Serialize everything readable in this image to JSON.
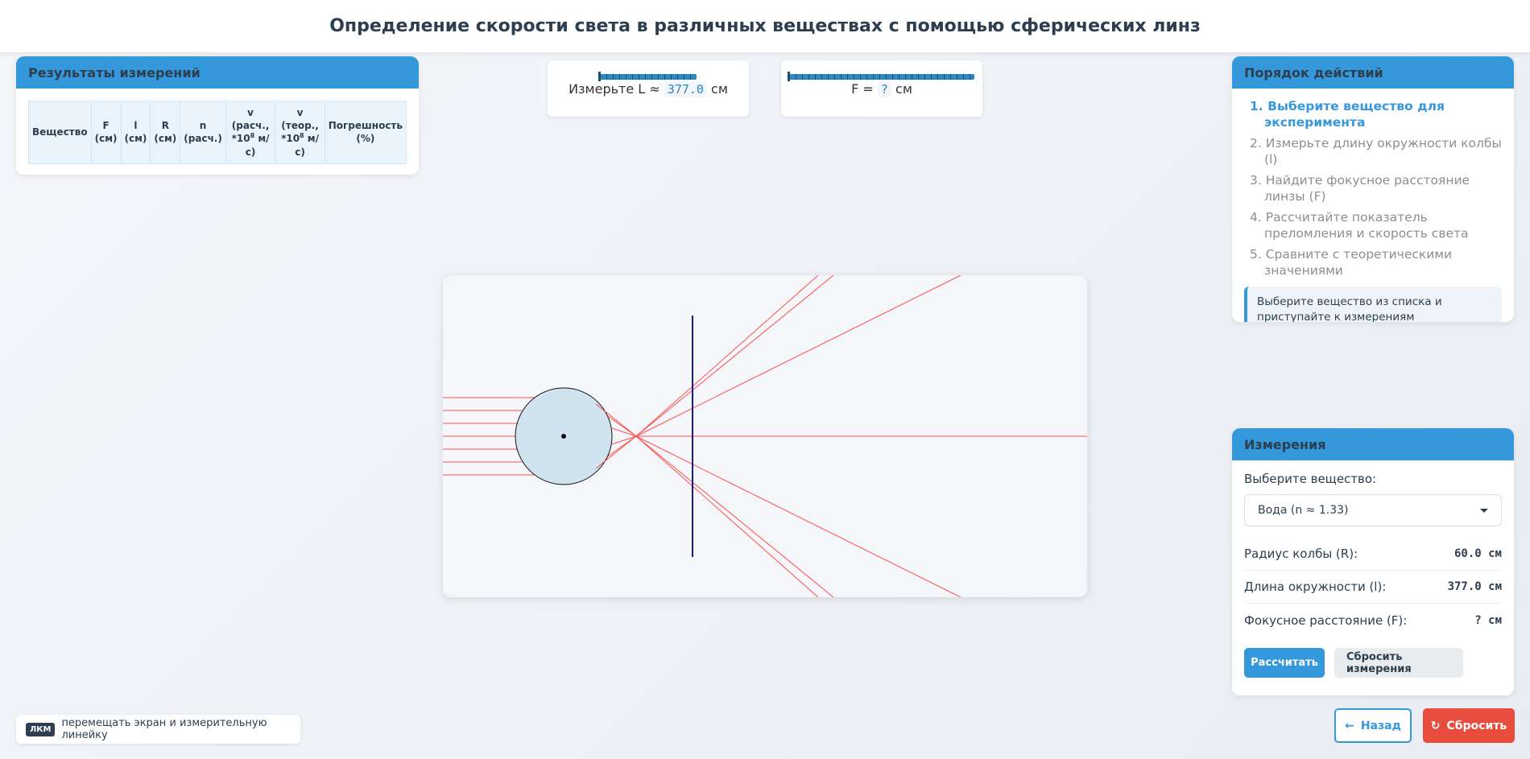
{
  "header": {
    "title": "Определение скорости света в различных веществах с помощью сферических линз"
  },
  "results": {
    "title": "Результаты измерений",
    "columns": [
      {
        "line1": "Вещество",
        "line2": ""
      },
      {
        "line1": "F",
        "line2": "(см)"
      },
      {
        "line1": "l",
        "line2": "(см)"
      },
      {
        "line1": "R",
        "line2": "(см)"
      },
      {
        "line1": "n",
        "line2": "(расч.)"
      },
      {
        "line1": "v (расч.,",
        "line2_pre": "*10",
        "sup": "8",
        "line2_post": " м/с)"
      },
      {
        "line1": "v (теор.,",
        "line2_pre": "*10",
        "sup": "8",
        "line2_post": " м/с)"
      },
      {
        "line1": "Погрешность",
        "line2": "(%)"
      }
    ]
  },
  "ruler_l": {
    "label": "Измерьте L ≈",
    "value": "377.0",
    "unit": "см"
  },
  "ruler_f": {
    "label": "F =",
    "value": "?",
    "unit": "см"
  },
  "steps": {
    "title": "Порядок действий",
    "items": [
      "1. Выберите вещество для эксперимента",
      "2. Измерьте длину окружности колбы (l)",
      "3. Найдите фокусное расстояние линзы (F)",
      "4. Рассчитайте показатель преломления и скорость света",
      "5. Сравните с теоретическими значениями"
    ],
    "hint": "Выберите вещество из списка и приступайте к измерениям"
  },
  "measurements": {
    "title": "Измерения",
    "select_label": "Выберите вещество:",
    "selected_substance": "Вода (n ≈ 1.33)",
    "radius_label": "Радиус колбы (R):",
    "radius_value": "60.0 см",
    "circ_label": "Длина окружности (l):",
    "circ_value": "377.0 см",
    "focal_label": "Фокусное расстояние (F):",
    "focal_value": "? см",
    "calc_button": "Рассчитать",
    "reset_measure_button": "Сбросить измерения"
  },
  "help": {
    "key": "ЛКМ",
    "text": "перемещать экран и измерительную линейку"
  },
  "nav": {
    "back": "Назад",
    "reset": "Сбросить"
  },
  "colors": {
    "accent": "#3498db",
    "danger": "#e74c3c",
    "ray": "#ff4d4d",
    "screen": "#1a1a8c",
    "flask": "#cfe4ee"
  }
}
